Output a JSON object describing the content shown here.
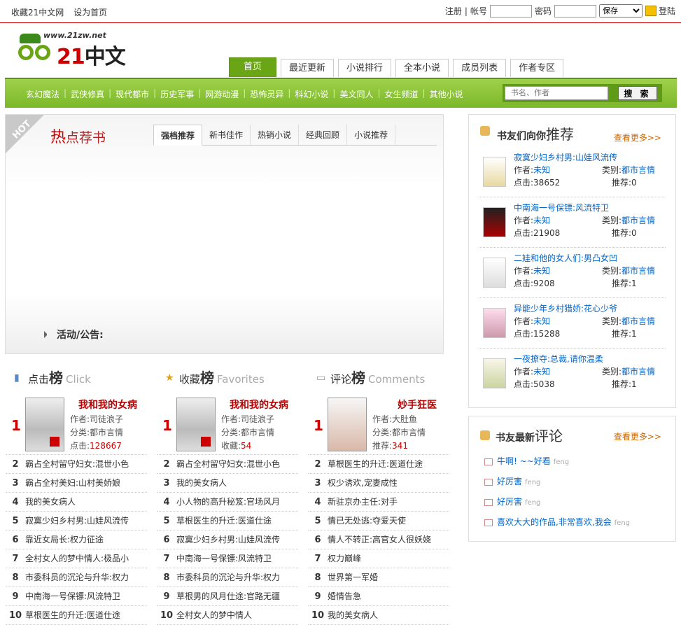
{
  "top": {
    "favorite": "收藏21中文网",
    "homepage": "设为首页",
    "register": "注册",
    "account_label": "帐号",
    "password_label": "密码",
    "save_option": "保存",
    "login": "登陆"
  },
  "logo": {
    "url": "www.21zw.net",
    "brand_num": "21",
    "brand_text": "中文"
  },
  "nav": [
    "首页",
    "最近更新",
    "小说排行",
    "全本小说",
    "成员列表",
    "作者专区"
  ],
  "categories": [
    "玄幻魔法",
    "武侠修真",
    "现代都市",
    "历史军事",
    "网游动漫",
    "恐怖灵异",
    "科幻小说",
    "美文同人",
    "女生频道",
    "其他小说"
  ],
  "search": {
    "placeholder": "书名、作者",
    "button": "搜 索"
  },
  "hot": {
    "corner": "HOT",
    "title_a": "热",
    "title_b": "点荐书",
    "tabs": [
      "强档推荐",
      "新书佳作",
      "热销小说",
      "经典回顾",
      "小说推荐"
    ],
    "notice": "活动/公告:"
  },
  "click_rank": {
    "title_a": "点击",
    "title_b": "榜",
    "en": "Click",
    "top": {
      "num": "1",
      "name": "我和我的女病",
      "author": "作者:司徒浪子",
      "cat": "分类:都市言情",
      "stat_label": "点击:",
      "stat": "128667"
    },
    "items": [
      [
        "2",
        "霸占全村留守妇女:混世小色"
      ],
      [
        "3",
        "霸占全村美妇:山村美娇娘"
      ],
      [
        "4",
        "我的美女病人"
      ],
      [
        "5",
        "寂寞少妇乡村男:山娃风流传"
      ],
      [
        "6",
        "靠近女局长:权力征途"
      ],
      [
        "7",
        "全村女人的梦中情人:极品小"
      ],
      [
        "8",
        "市委科员的沉沦与升华:权力"
      ],
      [
        "9",
        "中南海一号保镖:风流特卫"
      ],
      [
        "10",
        "草根医生的升迁:医道仕途"
      ]
    ]
  },
  "fav_rank": {
    "title_a": "收藏",
    "title_b": "榜",
    "en": "Favorites",
    "top": {
      "num": "1",
      "name": "我和我的女病",
      "author": "作者:司徒浪子",
      "cat": "分类:都市言情",
      "stat_label": "收藏:",
      "stat": "54"
    },
    "items": [
      [
        "2",
        "霸占全村留守妇女:混世小色"
      ],
      [
        "3",
        "我的美女病人"
      ],
      [
        "4",
        "小人物的高升秘笈:官场风月"
      ],
      [
        "5",
        "草根医生的升迁:医道仕途"
      ],
      [
        "6",
        "寂寞少妇乡村男:山娃风流传"
      ],
      [
        "7",
        "中南海一号保镖:风流特卫"
      ],
      [
        "8",
        "市委科员的沉沦与升华:权力"
      ],
      [
        "9",
        "草根男的风月仕途:官路无疆"
      ],
      [
        "10",
        "全村女人的梦中情人"
      ]
    ]
  },
  "cmt_rank": {
    "title_a": "评论",
    "title_b": "榜",
    "en": "Comments",
    "top": {
      "num": "1",
      "name": "妙手狂医",
      "author": "作者:大肚鱼",
      "cat": "分类:都市言情",
      "stat_label": "推荐:",
      "stat": "341"
    },
    "items": [
      [
        "2",
        "草根医生的升迁:医道仕途"
      ],
      [
        "3",
        "权少诱欢,宠妻成性"
      ],
      [
        "4",
        "新驻京办主任:对手"
      ],
      [
        "5",
        "情已无处逃:夺爱天使"
      ],
      [
        "6",
        "情人不转正:高官女人很妖娆"
      ],
      [
        "7",
        "权力巅峰"
      ],
      [
        "8",
        "世界第一军婚"
      ],
      [
        "9",
        "婚情告急"
      ],
      [
        "10",
        "我的美女病人"
      ]
    ]
  },
  "recommend": {
    "title_a": "书友们向你",
    "title_b": "推荐",
    "more": "查看更多>>",
    "books": [
      {
        "name": "寂寞少妇乡村男:山娃风流传",
        "author": "未知",
        "cat": "都市言情",
        "clicks": "38652",
        "rec": "0"
      },
      {
        "name": "中南海一号保镖:风流特卫",
        "author": "未知",
        "cat": "都市言情",
        "clicks": "21908",
        "rec": "0"
      },
      {
        "name": "二娃和他的女人们:男凸女凹",
        "author": "未知",
        "cat": "都市言情",
        "clicks": "9208",
        "rec": "1"
      },
      {
        "name": "异能少年乡村猎娇:花心少爷",
        "author": "未知",
        "cat": "都市言情",
        "clicks": "15288",
        "rec": "1"
      },
      {
        "name": "一夜撩夺:总裁,请你温柔",
        "author": "未知",
        "cat": "都市言情",
        "clicks": "5038",
        "rec": "1"
      }
    ],
    "labels": {
      "author": "作者:",
      "cat": "类别:",
      "click": "点击:",
      "rec": "推荐:"
    }
  },
  "comments": {
    "title_a": "书友最新",
    "title_b": "评论",
    "more": "查看更多>>",
    "items": [
      {
        "text": "牛啊! ~~好看",
        "user": "feng"
      },
      {
        "text": "好厉害",
        "user": "feng"
      },
      {
        "text": "好厉害",
        "user": "feng"
      },
      {
        "text": "喜欢大大的作品,非常喜欢,我会",
        "user": "feng"
      }
    ]
  }
}
